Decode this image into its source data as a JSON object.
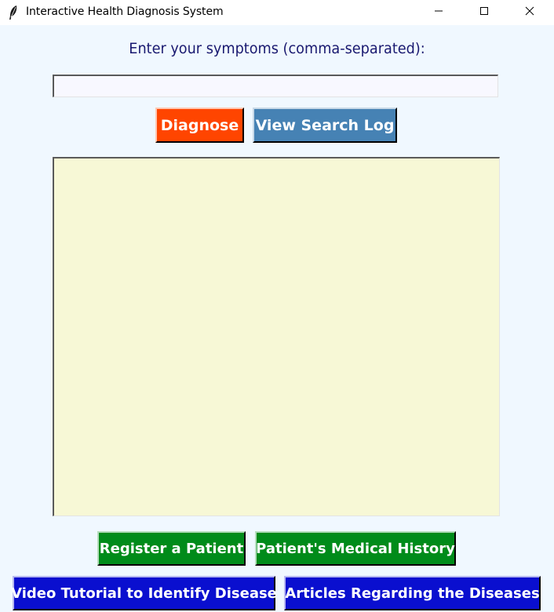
{
  "window": {
    "title": "Interactive Health Diagnosis System",
    "icon": "feather-icon",
    "controls": [
      "minimize-icon",
      "maximize-icon",
      "close-icon"
    ]
  },
  "form": {
    "prompt": "Enter your symptoms (comma-separated):",
    "symptoms_value": "",
    "results_text": ""
  },
  "buttons": {
    "diagnose": "Diagnose",
    "view_log": "View Search Log",
    "register": "Register a Patient",
    "history": "Patient's Medical History",
    "video": "Video Tutorial to Identify Disease",
    "articles": "Articles Regarding the Diseases"
  },
  "colors": {
    "background": "#f0f8ff",
    "prompt_text": "#191970",
    "diagnose": "#ff4500",
    "view_log": "#4682b4",
    "green_buttons": "#008b1a",
    "blue_buttons": "#0a0fcf",
    "results_bg": "#f7f8d6"
  }
}
